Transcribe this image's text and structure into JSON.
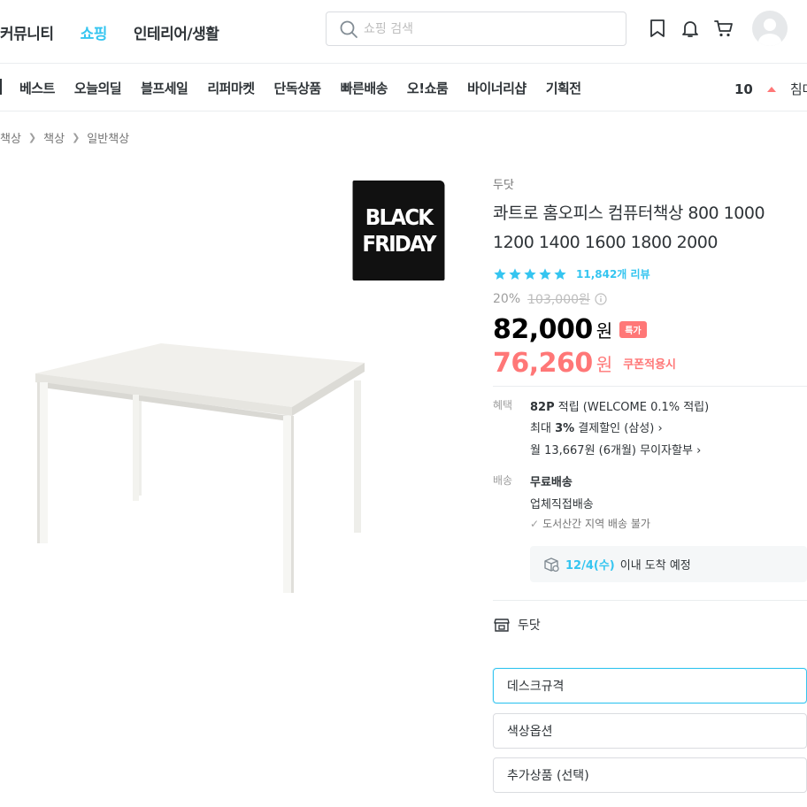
{
  "header": {
    "nav": [
      {
        "label": "커뮤니티",
        "active": false
      },
      {
        "label": "쇼핑",
        "active": true
      },
      {
        "label": "인테리어/생활",
        "active": false
      }
    ],
    "search": {
      "placeholder": "쇼핑 검색"
    },
    "icons": [
      "bookmark-icon",
      "bell-icon",
      "cart-icon",
      "avatar"
    ],
    "accent_color": "#35c5f0"
  },
  "category_nav": {
    "items": [
      "베스트",
      "오늘의딜",
      "블프세일",
      "리퍼마켓",
      "단독상품",
      "빠른배송",
      "오!쇼룸",
      "바이너리샵",
      "기획전"
    ],
    "ranking": {
      "number": "10",
      "text": "침대"
    }
  },
  "breadcrumb": [
    "책상",
    "책상",
    "일반책상"
  ],
  "badge": {
    "line1": "BLACK",
    "line2": "FRIDAY"
  },
  "product": {
    "brand": "두닷",
    "title": "콰트로 홈오피스 컴퓨터책상 800 1000 1200 1400 1600 1800 2000",
    "rating_stars": 5,
    "review_count": "11,842개 리뷰",
    "discount_rate": "20%",
    "original_price": "103,000원",
    "price": "82,000",
    "price_unit": "원",
    "special_badge": "특가",
    "coupon_price": "76,260",
    "coupon_unit": "원",
    "coupon_label": "쿠폰적용시",
    "price_color": "#ff7777"
  },
  "benefit": {
    "label": "혜택",
    "points_strong": "82P",
    "points_text": " 적립 (WELCOME 0.1% 적립)",
    "card_prefix": "최대 ",
    "card_strong": "3%",
    "card_text": " 결제할인 (삼성) ›",
    "installment": "월 13,667원 (6개월) 무이자할부 ›"
  },
  "shipping": {
    "label": "배송",
    "type": "무료배송",
    "method": "업체직접배송",
    "restriction": "도서산간 지역 배송 불가",
    "arrival_date": "12/4(수)",
    "arrival_text": "이내 도착 예정"
  },
  "store": {
    "name": "두닷"
  },
  "options": [
    "데스크규격",
    "색상옵션",
    "추가상품 (선택)"
  ]
}
